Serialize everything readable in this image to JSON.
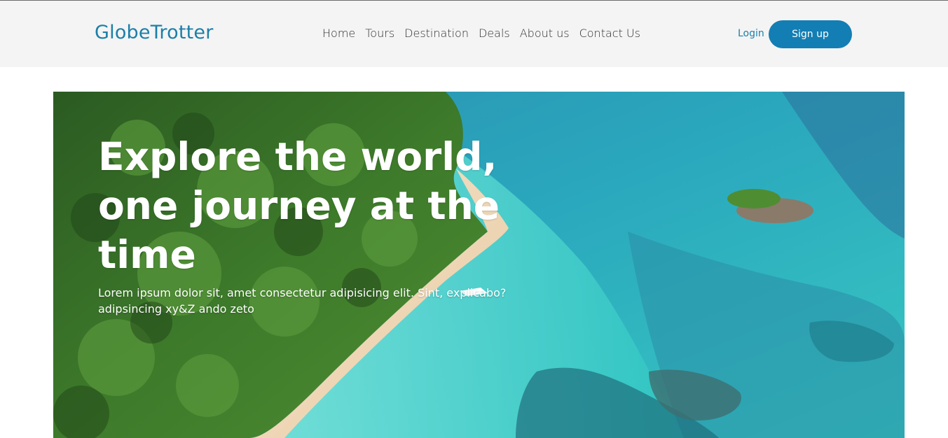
{
  "header": {
    "logo": "GlobeTrotter",
    "nav": [
      "Home",
      "Tours",
      "Destination",
      "Deals",
      "About us",
      "Contact Us"
    ],
    "login_label": "Login",
    "signup_label": "Sign up"
  },
  "hero": {
    "title_line1": "Explore the world,",
    "title_line2": "one journey at the time",
    "subtitle_line1": "Lorem ipsum dolor sit, amet consectetur adipisicing elit. Sint, explicabo?",
    "subtitle_line2": "adipsincing xy&Z ando zeto",
    "image_alt": "aerial-beach-photo"
  },
  "colors": {
    "brand": "#1c7fa8",
    "button": "#137eb3",
    "nav_bg": "#f4f4f4"
  }
}
